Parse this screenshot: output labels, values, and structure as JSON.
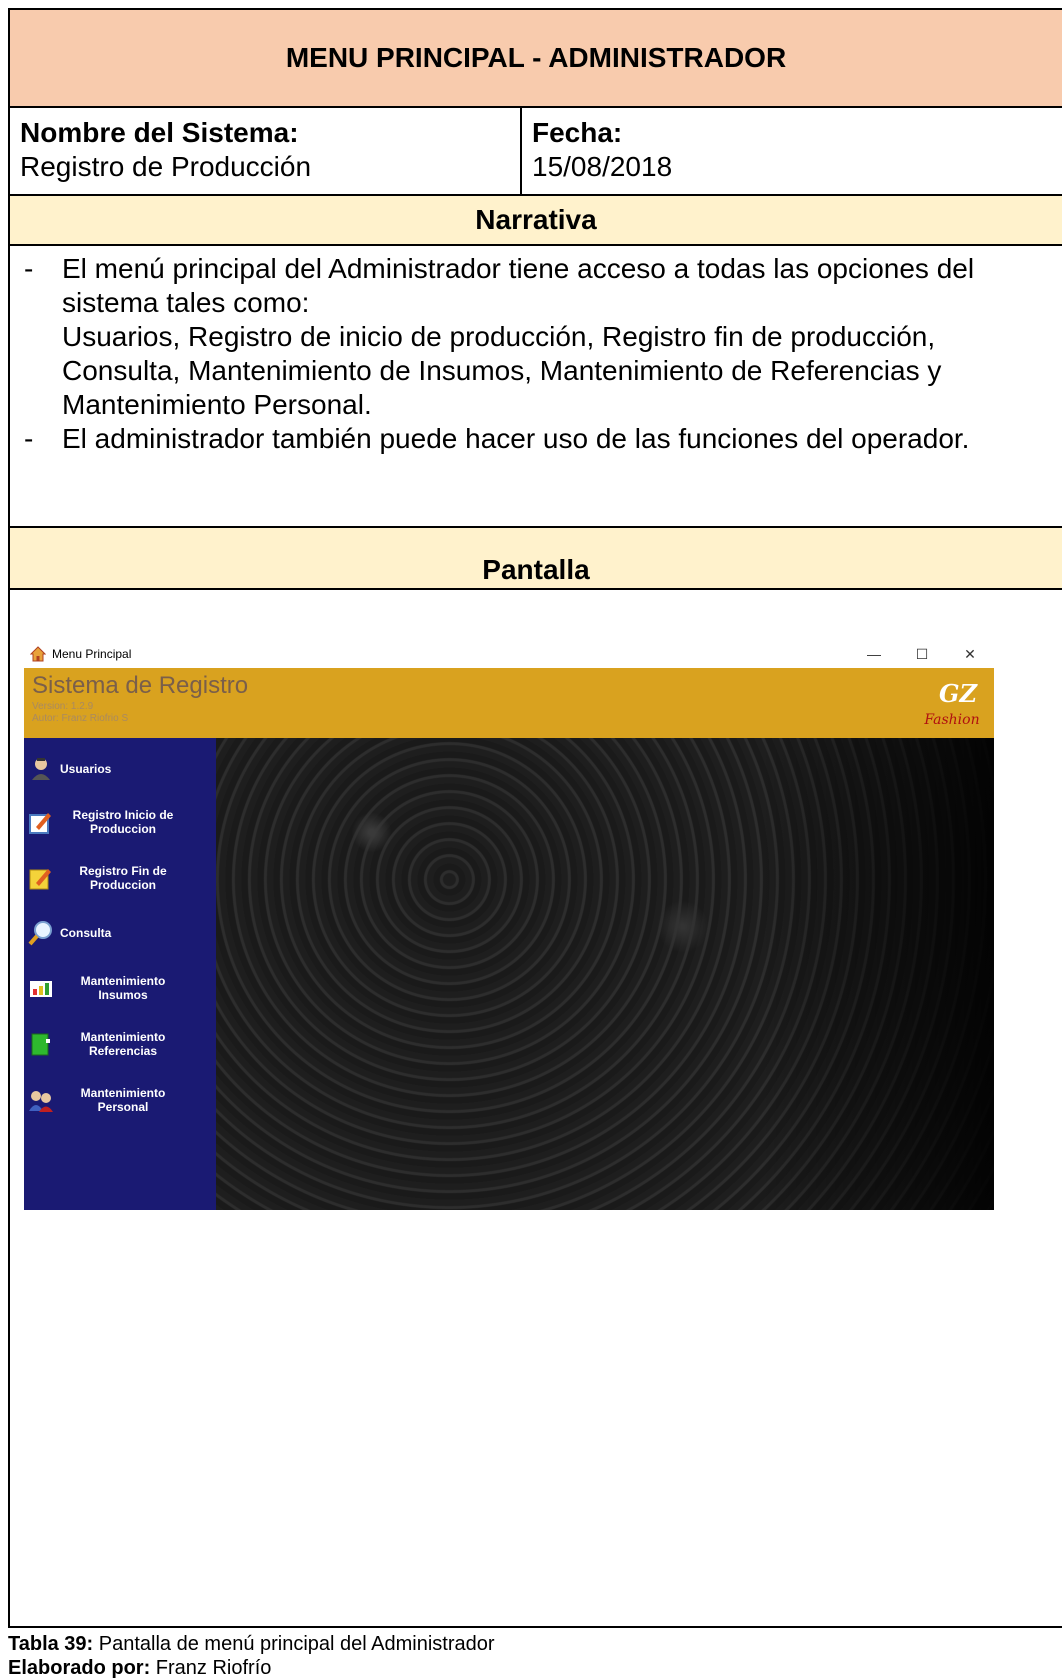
{
  "title": "MENU PRINCIPAL - ADMINISTRADOR",
  "info": {
    "system_label": "Nombre del Sistema:",
    "system_value": "Registro de Producción",
    "date_label": "Fecha:",
    "date_value": "15/08/2018"
  },
  "narrative": {
    "heading": "Narrativa",
    "bullets": [
      "El menú principal del Administrador tiene acceso a todas las opciones del sistema tales como:",
      "Usuarios, Registro de inicio de producción, Registro fin de producción, Consulta, Mantenimiento de Insumos, Mantenimiento de Referencias y Mantenimiento Personal.",
      "El administrador también puede hacer uso de las funciones del operador."
    ]
  },
  "screen": {
    "heading": "Pantalla",
    "window_title": "Menu Principal",
    "controls": {
      "minimize": "—",
      "maximize": "☐",
      "close": "✕"
    },
    "app_title": "Sistema de Registro",
    "version": "Version: 1.2.9",
    "author": "Autor: Franz Riofrio S",
    "logo_text": "GZ",
    "logo_sub": "Fashion",
    "menu": [
      {
        "label1": "Usuarios",
        "label2": "",
        "icon": "user-icon"
      },
      {
        "label1": "Registro Inicio de",
        "label2": "Produccion",
        "icon": "edit-icon"
      },
      {
        "label1": "Registro Fin de",
        "label2": "Produccion",
        "icon": "note-edit-icon"
      },
      {
        "label1": "Consulta",
        "label2": "",
        "icon": "search-icon"
      },
      {
        "label1": "Mantenimiento",
        "label2": "Insumos",
        "icon": "bar-chart-icon"
      },
      {
        "label1": "Mantenimiento",
        "label2": "Referencias",
        "icon": "book-icon"
      },
      {
        "label1": "Mantenimiento",
        "label2": "Personal",
        "icon": "people-icon"
      }
    ],
    "colors": {
      "header": "#d9a21f",
      "sidebar": "#1a1a73"
    }
  },
  "caption": {
    "table_label": "Tabla 39:",
    "table_text": " Pantalla de menú principal del Administrador",
    "by_label": "Elaborado por:",
    "by_text": " Franz Riofrío"
  }
}
